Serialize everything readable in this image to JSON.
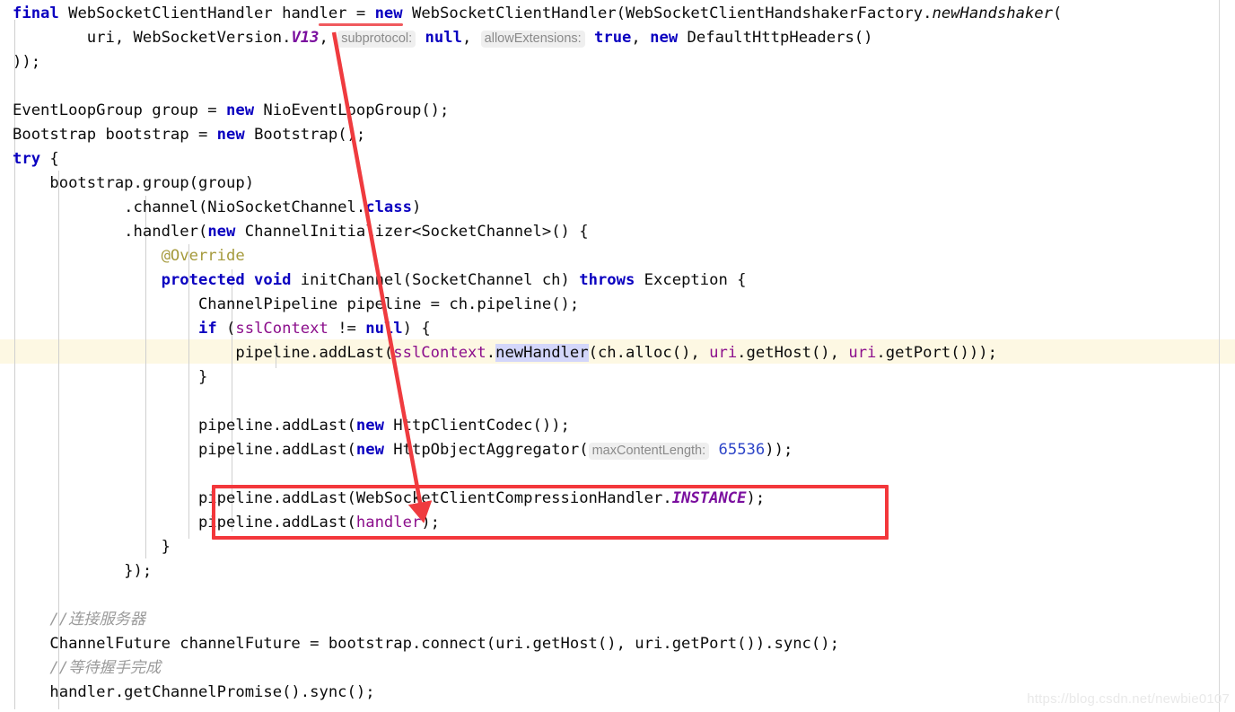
{
  "editor": {
    "background": "#ffffff",
    "highlight_line_color": "#fdf8e3",
    "selection_color": "#d3d6fa",
    "annotation_color": "#f3373b",
    "indent_guide_color": "#cfcfcf",
    "margin_guide_color": "#d8d8d8"
  },
  "code": {
    "line01": {
      "t1": "final ",
      "t2": "WebSocketClientHandler handler = ",
      "t3": "new ",
      "t4": "WebSocketClientHandler(WebSocketClientHandshakerFactory.",
      "t5": "newHandshaker",
      "t6": "("
    },
    "line02": {
      "t1": "        uri, WebSocketVersion.",
      "t2": "V13",
      "t3": ", ",
      "hint1": "subprotocol:",
      "t4": " ",
      "t5": "null",
      "t6": ", ",
      "hint2": "allowExtensions:",
      "t7": " ",
      "t8": "true",
      "t9": ", ",
      "t10": "new ",
      "t11": "DefaultHttpHeaders()"
    },
    "line03": {
      "t1": "));"
    },
    "line05": {
      "t1": "EventLoopGroup group = ",
      "t2": "new ",
      "t3": "NioEventLoopGroup();"
    },
    "line06": {
      "t1": "Bootstrap bootstrap = ",
      "t2": "new ",
      "t3": "Bootstrap();"
    },
    "line07": {
      "t1": "try",
      "t2": " {"
    },
    "line08": {
      "t1": "    bootstrap.group(group)"
    },
    "line09": {
      "t1": "            .channel(NioSocketChannel.",
      "t2": "class",
      "t3": ")"
    },
    "line10": {
      "t1": "            .handler(",
      "t2": "new ",
      "t3": "ChannelInitializer<SocketChannel>() {"
    },
    "line11": {
      "t1": "                @Override"
    },
    "line12": {
      "t1": "                ",
      "t2": "protected void ",
      "t3": "initChannel(SocketChannel ch) ",
      "t4": "throws ",
      "t5": "Exception {"
    },
    "line13": {
      "t1": "                    ChannelPipeline pipeline = ch.pipeline();"
    },
    "line14": {
      "t1": "                    ",
      "t2": "if ",
      "t3": "(",
      "t4": "sslContext",
      "t5": " != ",
      "t6": "null",
      "t7": ") {"
    },
    "line15": {
      "t1": "                        pipeline.addLast(",
      "t2": "sslContext",
      "t3": ".",
      "t4": "newHandler",
      "t5": "(ch.alloc(), ",
      "t6": "uri",
      "t7": ".getHost(), ",
      "t8": "uri",
      "t9": ".getPort()));"
    },
    "line16": {
      "t1": "                    }"
    },
    "line18": {
      "t1": "                    pipeline.addLast(",
      "t2": "new ",
      "t3": "HttpClientCodec());"
    },
    "line19": {
      "t1": "                    pipeline.addLast(",
      "t2": "new ",
      "t3": "HttpObjectAggregator(",
      "hint1": "maxContentLength:",
      "t4": " ",
      "t5": "65536",
      "t6": "));"
    },
    "line21": {
      "t1": "                    pipeline.addLast(WebSocketClientCompressionHandler.",
      "t2": "INSTANCE",
      "t3": ");"
    },
    "line22": {
      "t1": "                    pipeline.addLast(",
      "t2": "handler",
      "t3": ");"
    },
    "line23": {
      "t1": "                }"
    },
    "line24": {
      "t1": "            });"
    },
    "line26": {
      "t1": "    //连接服务器"
    },
    "line27": {
      "t1": "    ChannelFuture channelFuture = bootstrap.connect(uri.getHost(), uri.getPort()).sync();"
    },
    "line28": {
      "t1": "    //等待握手完成"
    },
    "line29": {
      "t1": "    handler.getChannelPromise().sync();"
    }
  },
  "annotations": {
    "underline_target": "handler",
    "arrow_from": "handler (declaration, line 1)",
    "arrow_to": "handler (pipeline.addLast argument)",
    "box_label": "pipeline.addLast highlight box"
  },
  "watermark": {
    "text": "https://blog.csdn.net/newbie0107"
  }
}
